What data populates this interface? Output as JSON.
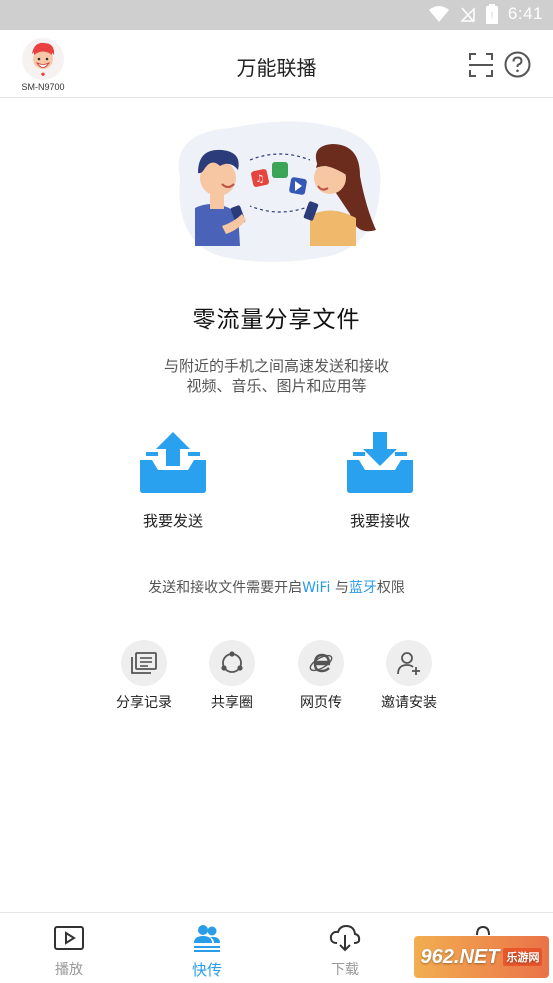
{
  "status_bar": {
    "time": "6:41"
  },
  "header": {
    "device_name": "SM-N9700",
    "title": "万能联播"
  },
  "hero": {
    "headline": "零流量分享文件",
    "subtitle_line1": "与附近的手机之间高速发送和接收",
    "subtitle_line2": "视频、音乐、图片和应用等"
  },
  "actions": {
    "send_label": "我要发送",
    "receive_label": "我要接收"
  },
  "permission": {
    "prefix": "发送和接收文件需要开启",
    "wifi": "WiFi",
    "middle": " 与",
    "bluetooth": "蓝牙",
    "suffix": "权限"
  },
  "tools": [
    {
      "label": "分享记录",
      "icon": "history-icon"
    },
    {
      "label": "共享圈",
      "icon": "share-circle-icon"
    },
    {
      "label": "网页传",
      "icon": "browser-icon"
    },
    {
      "label": "邀请安装",
      "icon": "invite-user-icon"
    }
  ],
  "tabs": [
    {
      "label": "播放",
      "icon": "play-icon",
      "active": false
    },
    {
      "label": "快传",
      "icon": "transfer-users-icon",
      "active": true
    },
    {
      "label": "下载",
      "icon": "download-cloud-icon",
      "active": false
    },
    {
      "label": "",
      "icon": "more-icon",
      "active": false
    }
  ],
  "watermark": {
    "main": "962.NET",
    "sub": "乐游网"
  },
  "colors": {
    "accent": "#2a9de8",
    "status_bar": "#cfcfcf"
  }
}
